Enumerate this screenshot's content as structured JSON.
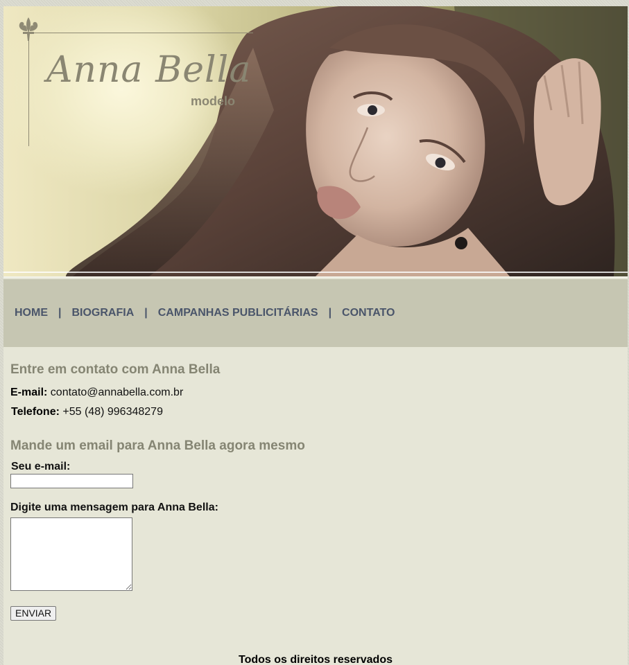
{
  "header": {
    "logo_name": "Anna Bella",
    "logo_sub": "modelo"
  },
  "nav": {
    "items": [
      "HOME",
      "BIOGRAFIA",
      "CAMPANHAS PUBLICITÁRIAS",
      "CONTATO"
    ],
    "separator": "|"
  },
  "contact": {
    "heading": "Entre em contato com Anna Bella",
    "email_label": "E-mail:",
    "email_value": "contato@annabella.com.br",
    "phone_label": "Telefone:",
    "phone_value": "+55 (48) 996348279"
  },
  "form": {
    "heading": "Mande um email para Anna Bella agora mesmo",
    "email_field_label": "Seu e-mail:",
    "email_field_value": "",
    "message_label": "Digite uma mensagem para Anna Bella:",
    "message_value": "",
    "submit_label": "ENVIAR"
  },
  "footer": {
    "text": "Todos os direitos reservados"
  },
  "colors": {
    "page_bg": "#e6e6d7",
    "nav_bg": "#c6c6b2",
    "nav_text": "#4a556a",
    "heading": "#858573",
    "logo": "#8a8672"
  }
}
